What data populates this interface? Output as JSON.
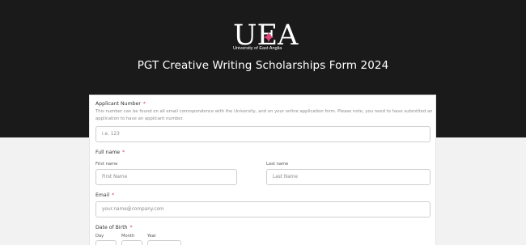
{
  "header": {
    "logo_text": "UEA",
    "logo_subtitle": "University of East Anglia",
    "title": "PGT Creative Writing Scholarships Form 2024"
  },
  "colors": {
    "header_bg": "#1b1a1a",
    "required": "#d9426b",
    "logo_spark": "#e5447b"
  },
  "form": {
    "applicant_number": {
      "label": "Applicant Number",
      "required_mark": "*",
      "help_line1": "This number can be found on all email correspondence with the University, and on your online application form. Please note, you need to have submitted an",
      "help_line2": "application to have an applicant number.",
      "placeholder": "i.e. 123"
    },
    "full_name": {
      "label": "Full name",
      "required_mark": "*",
      "first_label": "First name",
      "first_placeholder": "First Name",
      "last_label": "Last name",
      "last_placeholder": "Last Name"
    },
    "email": {
      "label": "Email",
      "required_mark": "*",
      "placeholder": "your.name@company.com"
    },
    "dob": {
      "label": "Date of Birth",
      "required_mark": "*",
      "day_label": "Day",
      "month_label": "Month",
      "year_label": "Year"
    }
  }
}
